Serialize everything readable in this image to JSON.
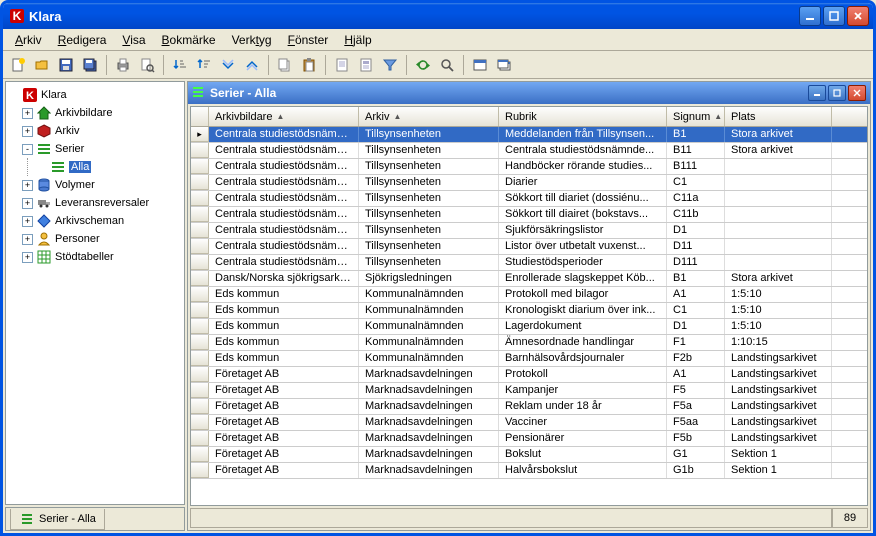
{
  "window": {
    "title": "Klara"
  },
  "menu": [
    "Arkiv",
    "Redigera",
    "Visa",
    "Bokmärke",
    "Verktyg",
    "Fönster",
    "Hjälp"
  ],
  "tree": {
    "root": "Klara",
    "nodes": [
      {
        "label": "Arkivbildare",
        "expand": "+",
        "icon": "home-green"
      },
      {
        "label": "Arkiv",
        "expand": "+",
        "icon": "hex-red"
      },
      {
        "label": "Serier",
        "expand": "-",
        "icon": "bars-green",
        "children": [
          {
            "label": "Alla",
            "icon": "bars-green",
            "selected": true
          }
        ]
      },
      {
        "label": "Volymer",
        "expand": "+",
        "icon": "cylinder-blue"
      },
      {
        "label": "Leveransreversaler",
        "expand": "+",
        "icon": "truck"
      },
      {
        "label": "Arkivscheman",
        "expand": "+",
        "icon": "diamond-blue"
      },
      {
        "label": "Personer",
        "expand": "+",
        "icon": "person-yellow"
      },
      {
        "label": "Stödtabeller",
        "expand": "+",
        "icon": "grid-green"
      }
    ]
  },
  "bottom_tab": {
    "label": "Serier - Alla",
    "icon": "bars-green"
  },
  "inner_window": {
    "title": "Serier - Alla"
  },
  "grid": {
    "columns": [
      {
        "label": "Arkivbildare",
        "sort": "asc"
      },
      {
        "label": "Arkiv",
        "sort": "asc"
      },
      {
        "label": "Rubrik",
        "sort": ""
      },
      {
        "label": "Signum",
        "sort": "asc"
      },
      {
        "label": "Plats",
        "sort": ""
      }
    ],
    "rows": [
      {
        "c": [
          "Centrala studiestödsnämnden",
          "Tillsynsenheten",
          "Meddelanden från Tillsynsen...",
          "B1",
          "Stora arkivet"
        ],
        "selected": true
      },
      {
        "c": [
          "Centrala studiestödsnämnden",
          "Tillsynsenheten",
          "Centrala studiestödsnämnde...",
          "B11",
          "Stora arkivet"
        ]
      },
      {
        "c": [
          "Centrala studiestödsnämnden",
          "Tillsynsenheten",
          "Handböcker rörande studies...",
          "B111",
          ""
        ]
      },
      {
        "c": [
          "Centrala studiestödsnämnden",
          "Tillsynsenheten",
          "Diarier",
          "C1",
          ""
        ]
      },
      {
        "c": [
          "Centrala studiestödsnämnden",
          "Tillsynsenheten",
          "Sökkort till diariet (dossiénu...",
          "C11a",
          ""
        ]
      },
      {
        "c": [
          "Centrala studiestödsnämnden",
          "Tillsynsenheten",
          "Sökkort till diairet (bokstavs...",
          "C11b",
          ""
        ]
      },
      {
        "c": [
          "Centrala studiestödsnämnden",
          "Tillsynsenheten",
          "Sjukförsäkringslistor",
          "D1",
          ""
        ]
      },
      {
        "c": [
          "Centrala studiestödsnämnden",
          "Tillsynsenheten",
          "Listor över utbetalt vuxenst...",
          "D11",
          ""
        ]
      },
      {
        "c": [
          "Centrala studiestödsnämnden",
          "Tillsynsenheten",
          "Studiestödsperioder",
          "D111",
          ""
        ]
      },
      {
        "c": [
          "Dansk/Norska sjökrigsarkivet",
          "Sjökrigsledningen",
          "Enrollerade slagskeppet Köb...",
          "B1",
          "Stora arkivet"
        ]
      },
      {
        "c": [
          "Eds kommun",
          "Kommunalnämnden",
          "Protokoll med bilagor",
          "A1",
          "1:5:10"
        ]
      },
      {
        "c": [
          "Eds kommun",
          "Kommunalnämnden",
          "Kronologiskt diarium över ink...",
          "C1",
          "1:5:10"
        ]
      },
      {
        "c": [
          "Eds kommun",
          "Kommunalnämnden",
          "Lagerdokument",
          "D1",
          "1:5:10"
        ]
      },
      {
        "c": [
          "Eds kommun",
          "Kommunalnämnden",
          "Ämnesordnade handlingar",
          "F1",
          "1:10:15"
        ]
      },
      {
        "c": [
          "Eds kommun",
          "Kommunalnämnden",
          "Barnhälsovårdsjournaler",
          "F2b",
          "Landstingsarkivet"
        ]
      },
      {
        "c": [
          "Företaget AB",
          "Marknadsavdelningen",
          "Protokoll",
          "A1",
          "Landstingsarkivet"
        ]
      },
      {
        "c": [
          "Företaget AB",
          "Marknadsavdelningen",
          "Kampanjer",
          "F5",
          "Landstingsarkivet"
        ]
      },
      {
        "c": [
          "Företaget AB",
          "Marknadsavdelningen",
          "Reklam under 18 år",
          "F5a",
          "Landstingsarkivet"
        ]
      },
      {
        "c": [
          "Företaget AB",
          "Marknadsavdelningen",
          "Vacciner",
          "F5aa",
          "Landstingsarkivet"
        ]
      },
      {
        "c": [
          "Företaget AB",
          "Marknadsavdelningen",
          "Pensionärer",
          "F5b",
          "Landstingsarkivet"
        ]
      },
      {
        "c": [
          "Företaget AB",
          "Marknadsavdelningen",
          "Bokslut",
          "G1",
          "Sektion 1"
        ]
      },
      {
        "c": [
          "Företaget AB",
          "Marknadsavdelningen",
          "Halvårsbokslut",
          "G1b",
          "Sektion 1"
        ]
      }
    ]
  },
  "status": {
    "count": "89"
  },
  "icons": {
    "K": "K"
  }
}
